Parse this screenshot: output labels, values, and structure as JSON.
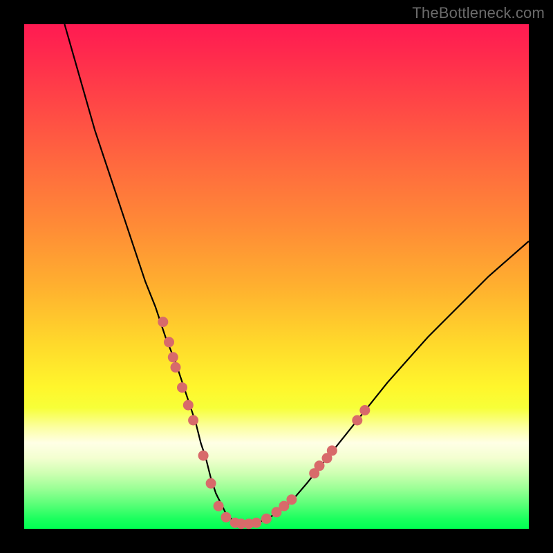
{
  "watermark": "TheBottleneck.com",
  "chart_data": {
    "type": "line",
    "title": "",
    "xlabel": "",
    "ylabel": "",
    "xlim": [
      0,
      100
    ],
    "ylim": [
      0,
      100
    ],
    "grid": false,
    "legend": false,
    "background": "rainbow-vertical-gradient",
    "series": [
      {
        "name": "curve",
        "x": [
          8,
          10,
          12,
          14,
          16,
          18,
          20,
          22,
          24,
          26,
          28,
          30,
          32,
          34,
          35,
          36,
          37,
          38,
          39,
          40,
          41,
          42,
          43,
          44,
          45,
          47,
          50,
          53,
          56,
          60,
          64,
          68,
          72,
          76,
          80,
          84,
          88,
          92,
          96,
          100
        ],
        "y": [
          100,
          93,
          86,
          79,
          73,
          67,
          61,
          55,
          49,
          44,
          38,
          33,
          27,
          21,
          17,
          14,
          10,
          7,
          5,
          3,
          2,
          1.3,
          1,
          1,
          1,
          1.5,
          3,
          5.5,
          9,
          14,
          19,
          24,
          29,
          33.5,
          38,
          42,
          46,
          50,
          53.5,
          57
        ]
      }
    ],
    "markers": {
      "name": "data-points",
      "color": "#d86a6a",
      "points": [
        {
          "x": 27.5,
          "y": 41
        },
        {
          "x": 28.7,
          "y": 37
        },
        {
          "x": 29.5,
          "y": 34
        },
        {
          "x": 30.0,
          "y": 32
        },
        {
          "x": 31.3,
          "y": 28
        },
        {
          "x": 32.5,
          "y": 24.5
        },
        {
          "x": 33.5,
          "y": 21.5
        },
        {
          "x": 35.5,
          "y": 14.5
        },
        {
          "x": 37.0,
          "y": 9
        },
        {
          "x": 38.5,
          "y": 4.5
        },
        {
          "x": 40.0,
          "y": 2.3
        },
        {
          "x": 41.8,
          "y": 1.2
        },
        {
          "x": 43.0,
          "y": 1
        },
        {
          "x": 44.5,
          "y": 1
        },
        {
          "x": 46.0,
          "y": 1.2
        },
        {
          "x": 48.0,
          "y": 2
        },
        {
          "x": 50.0,
          "y": 3.3
        },
        {
          "x": 51.5,
          "y": 4.5
        },
        {
          "x": 53.0,
          "y": 5.8
        },
        {
          "x": 57.5,
          "y": 11
        },
        {
          "x": 58.5,
          "y": 12.5
        },
        {
          "x": 60.0,
          "y": 14
        },
        {
          "x": 61.0,
          "y": 15.5
        },
        {
          "x": 66.0,
          "y": 21.5
        },
        {
          "x": 67.5,
          "y": 23.5
        }
      ]
    }
  }
}
